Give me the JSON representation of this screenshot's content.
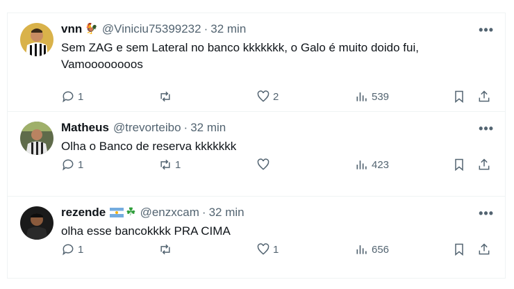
{
  "tweets": [
    {
      "name": "vnn",
      "emoji": "🐓",
      "handle": "@Viniciu75399232",
      "time": "32 min",
      "text_lines": [
        "Sem ZAG e sem Lateral no banco kkkkkkk, o Galo é muito doido fui,",
        "Vamoooooooos"
      ],
      "replies": "1",
      "retweets": "",
      "likes": "2",
      "views": "539"
    },
    {
      "name": "Matheus",
      "emoji": "",
      "handle": "@trevorteibo",
      "time": "32 min",
      "text_lines": [
        "Olha o Banco de reserva kkkkkkk"
      ],
      "replies": "1",
      "retweets": "1",
      "likes": "",
      "views": "423"
    },
    {
      "name": "rezende",
      "emoji": "☘",
      "handle": "@enzxcam",
      "time": "32 min",
      "text_lines": [
        "olha esse bancokkkk PRA CIMA"
      ],
      "replies": "1",
      "retweets": "",
      "likes": "1",
      "views": "656"
    }
  ],
  "more_label": "•••",
  "dot": "·",
  "icons": {
    "reply": "reply-icon",
    "retweet": "retweet-icon",
    "like": "heart-icon",
    "views": "views-icon",
    "bookmark": "bookmark-icon",
    "share": "share-icon",
    "flag": "argentina-flag-icon"
  },
  "colors": {
    "secondary": "#536471",
    "text": "#0f1419",
    "border": "#eff3f4"
  }
}
